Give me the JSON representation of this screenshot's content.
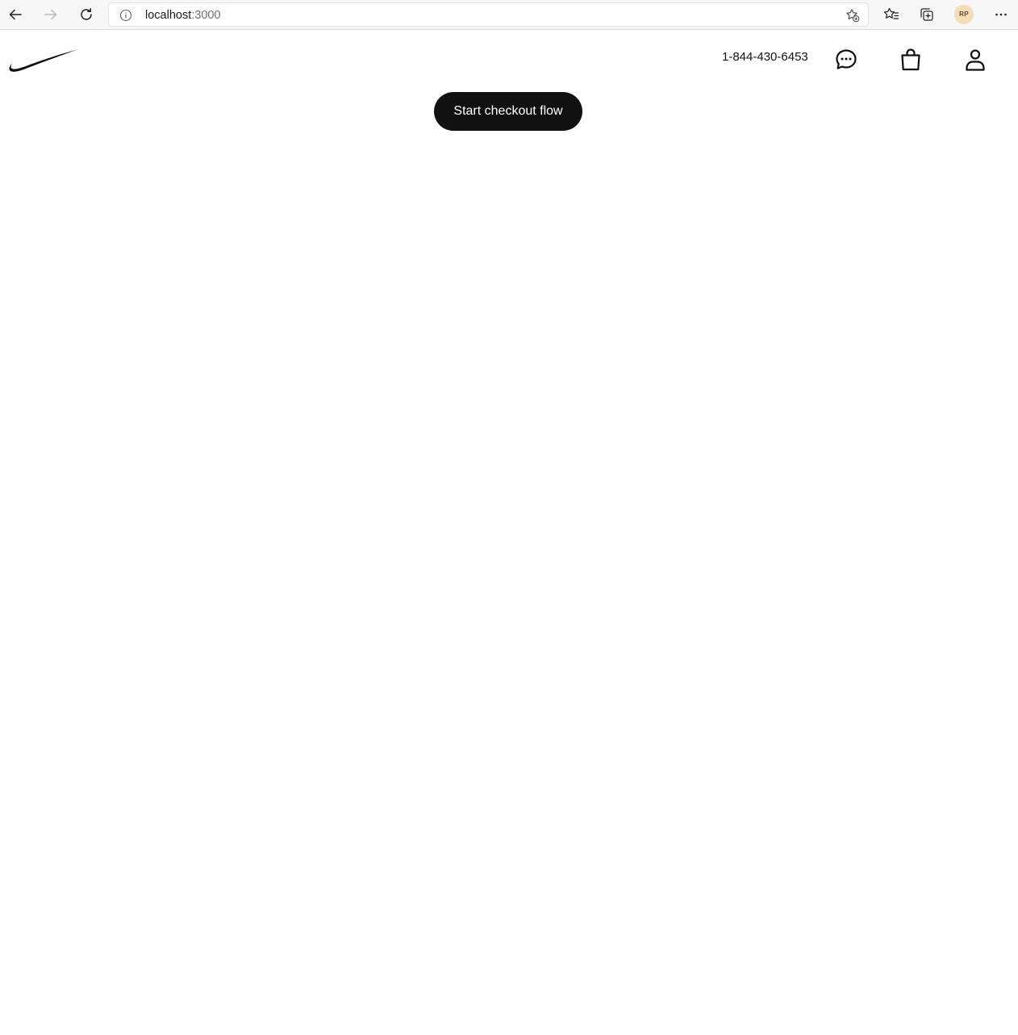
{
  "browser": {
    "url_host": "localhost",
    "url_port": ":3000",
    "profile_initials": "RP"
  },
  "header": {
    "phone": "1-844-430-6453",
    "icons": [
      "chat-icon",
      "shopping-bag-icon",
      "user-account-icon"
    ]
  },
  "main": {
    "cta_label": "Start checkout flow"
  },
  "colors": {
    "primary": "#111111",
    "background": "#ffffff",
    "browser_chrome": "#f7f7f7",
    "avatar": "#f6ddb8"
  }
}
